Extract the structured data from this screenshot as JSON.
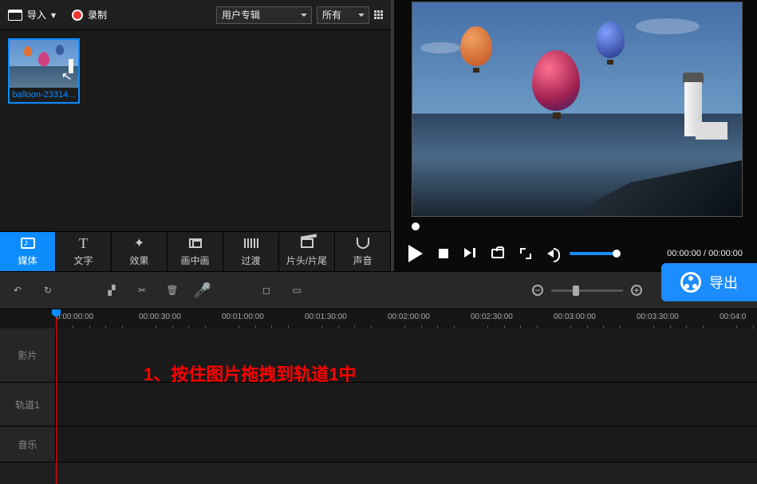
{
  "topbar": {
    "import": "导入",
    "record": "录制",
    "select1": "用户专辑",
    "select2": "所有"
  },
  "media": {
    "thumb_name": "balloon-23314..."
  },
  "tabs": [
    {
      "id": "media",
      "label": "媒体",
      "active": true
    },
    {
      "id": "text",
      "label": "文字"
    },
    {
      "id": "effect",
      "label": "效果"
    },
    {
      "id": "pip",
      "label": "画中画"
    },
    {
      "id": "transition",
      "label": "过渡"
    },
    {
      "id": "title",
      "label": "片头/片尾"
    },
    {
      "id": "audio",
      "label": "声音"
    }
  ],
  "preview": {
    "time_current": "00:00:00",
    "time_total": "00:00:00"
  },
  "export_label": "导出",
  "timeline": {
    "ticks": [
      "0:00:00:00",
      "00:00:30:00",
      "00:01:00:00",
      "00:01:30:00",
      "00:02:00:00",
      "00:02:30:00",
      "00:03:00:00",
      "00:03:30:00",
      "00:04:0"
    ],
    "tracks": {
      "video": "影片",
      "track1": "轨道1",
      "music": "音乐"
    },
    "annotation": "1、按住图片拖拽到轨道1中"
  }
}
